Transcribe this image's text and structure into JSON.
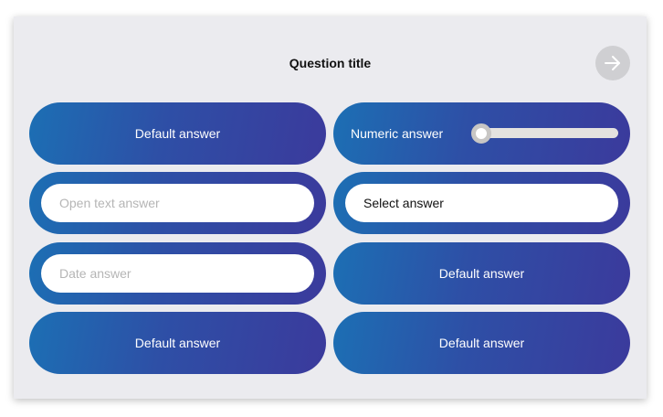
{
  "question": {
    "title": "Question title"
  },
  "next_button": {
    "icon": "arrow-right-icon",
    "color": "#cfcfd2"
  },
  "answers": {
    "default_1": "Default answer",
    "numeric": {
      "label": "Numeric answer",
      "slider_value": 0
    },
    "open_text": {
      "placeholder": "Open text answer",
      "value": ""
    },
    "select": {
      "value": "Select answer"
    },
    "date": {
      "placeholder": "Date answer",
      "value": ""
    },
    "default_2": "Default answer",
    "default_3": "Default answer",
    "default_4": "Default answer"
  },
  "colors": {
    "gradient_start": "#1c6fb4",
    "gradient_end": "#3b3a9c",
    "card_background": "#ebebef"
  }
}
